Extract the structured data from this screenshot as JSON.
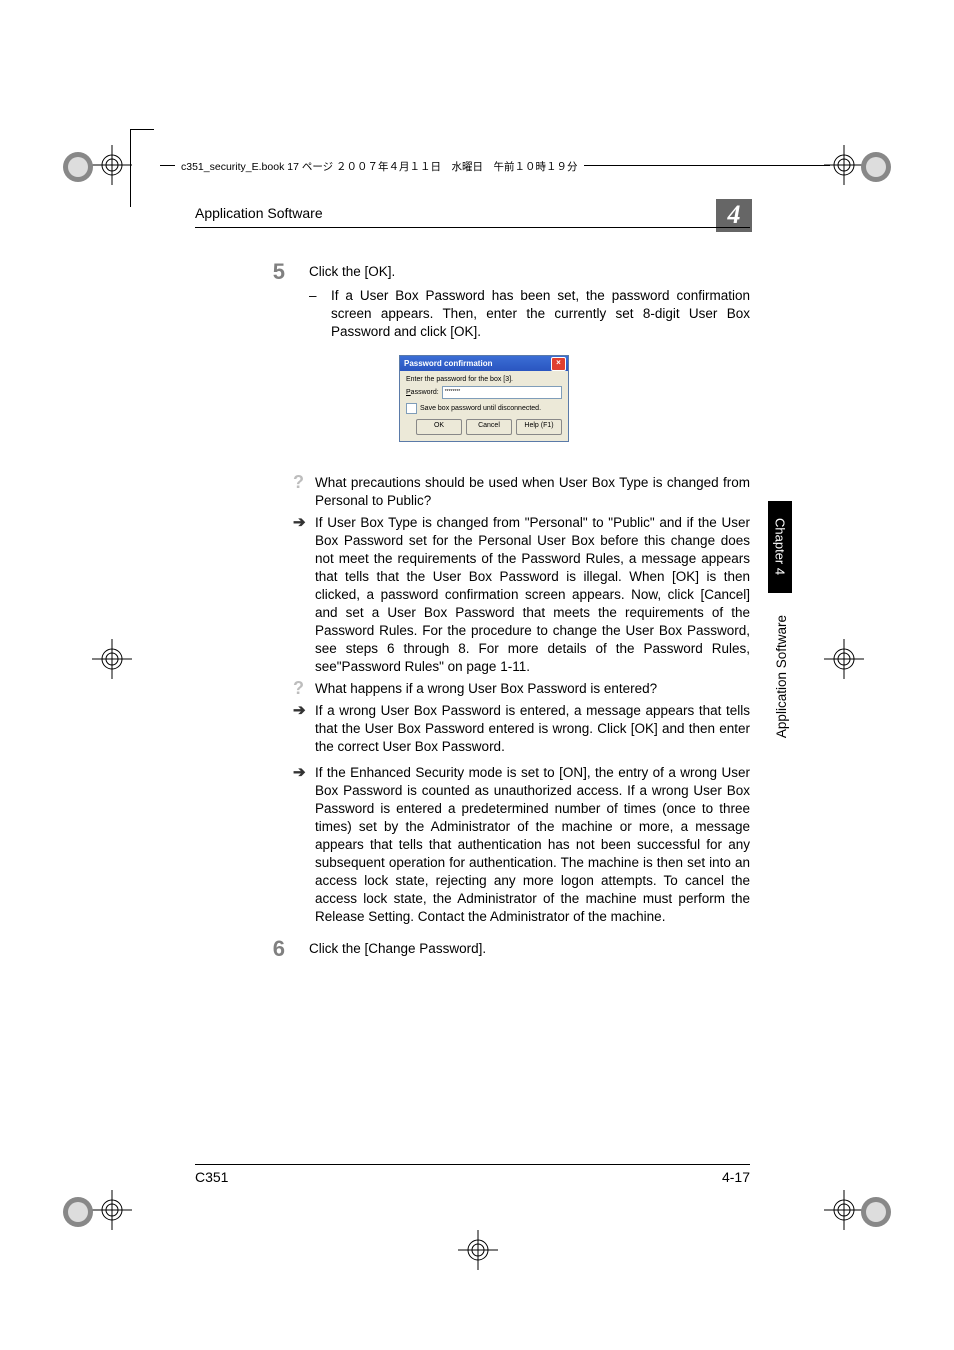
{
  "bookHeader": "c351_security_E.book  17 ページ  ２００７年４月１１日　水曜日　午前１０時１９分",
  "header": {
    "title": "Application Software",
    "chapter": "4"
  },
  "steps": {
    "s5": {
      "num": "5",
      "text": "Click the [OK].",
      "sub1": "If a User Box Password has been set, the password confirmation screen appears. Then, enter the currently set 8-digit User Box Password and click [OK]."
    },
    "s6": {
      "num": "6",
      "text": "Click the [Change Password]."
    }
  },
  "dialog": {
    "title": "Password confirmation",
    "prompt": "Enter the password for the box [3].",
    "passwordLabel": "Password:",
    "passwordValue": "********",
    "checkbox": "Save box password until disconnected.",
    "ok": "OK",
    "cancel": "Cancel",
    "help": "Help (F1)"
  },
  "qa": {
    "q1": "What precautions should be used when User Box Type is changed from Personal to Public?",
    "a1": "If User Box Type is changed from \"Personal\" to \"Public\" and if the User Box Password set for the Personal User Box before this change does not meet the requirements of the Password Rules, a message appears that tells that the User Box Password is illegal. When [OK] is then clicked, a password confirmation screen appears. Now, click [Cancel] and set a User Box Password that meets the requirements of the Password Rules. For the procedure to change the User Box Password, see steps 6 through 8. For more details of the Password Rules, see\"Password Rules\" on page 1-11.",
    "q2": "What happens if a wrong User Box Password is entered?",
    "a2": "If a wrong User Box Password is entered, a message appears that tells that the User Box Password entered is wrong. Click [OK] and then enter the correct User Box Password.",
    "a3": "If the Enhanced Security mode is set to [ON], the entry of a wrong User Box Password is counted as unauthorized access. If a wrong User Box Password is entered a predetermined number of times (once to three times) set by the Administrator of the machine or more, a message appears that tells that authentication has not been successful for any subsequent operation for authentication. The machine is then set into an access lock state, rejecting any more logon attempts. To cancel the access lock state, the Administrator of the machine must perform the Release Setting. Contact the Administrator of the machine."
  },
  "sideTab": "Chapter 4",
  "sideLabel": "Application Software",
  "footer": {
    "left": "C351",
    "right": "4-17"
  }
}
